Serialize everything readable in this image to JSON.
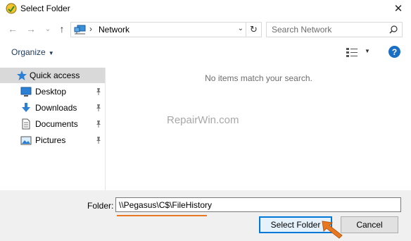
{
  "window": {
    "title": "Select Folder",
    "close_glyph": "✕"
  },
  "navigation": {
    "back_glyph": "←",
    "forward_glyph": "→",
    "recent_glyph": "⌄",
    "up_glyph": "↑",
    "address": {
      "separator": "›",
      "location": "Network",
      "dropdown_glyph": "⌄"
    },
    "refresh_glyph": "↻",
    "search": {
      "placeholder": "Search Network"
    }
  },
  "toolbar": {
    "organize_label": "Organize",
    "organize_caret": "▼",
    "view_caret": "▼",
    "help_label": "?"
  },
  "sidebar": {
    "items": [
      {
        "label": "Quick access",
        "icon": "star-icon",
        "pinned": false,
        "selected": true
      },
      {
        "label": "Desktop",
        "icon": "desktop-icon",
        "pinned": true,
        "selected": false
      },
      {
        "label": "Downloads",
        "icon": "download-icon",
        "pinned": true,
        "selected": false
      },
      {
        "label": "Documents",
        "icon": "document-icon",
        "pinned": true,
        "selected": false
      },
      {
        "label": "Pictures",
        "icon": "picture-icon",
        "pinned": true,
        "selected": false
      }
    ]
  },
  "content": {
    "empty_message": "No items match your search.",
    "watermark": "RepairWin.com"
  },
  "footer": {
    "folder_label": "Folder:",
    "folder_value": "\\\\Pegasus\\C$\\FileHistory",
    "select_button_label": "Select Folder",
    "cancel_button_label": "Cancel"
  },
  "colors": {
    "accent": "#0078d7",
    "annotation": "#e87722",
    "selected_bg": "#d9d9d9",
    "footer_bg": "#f0f0f0"
  }
}
